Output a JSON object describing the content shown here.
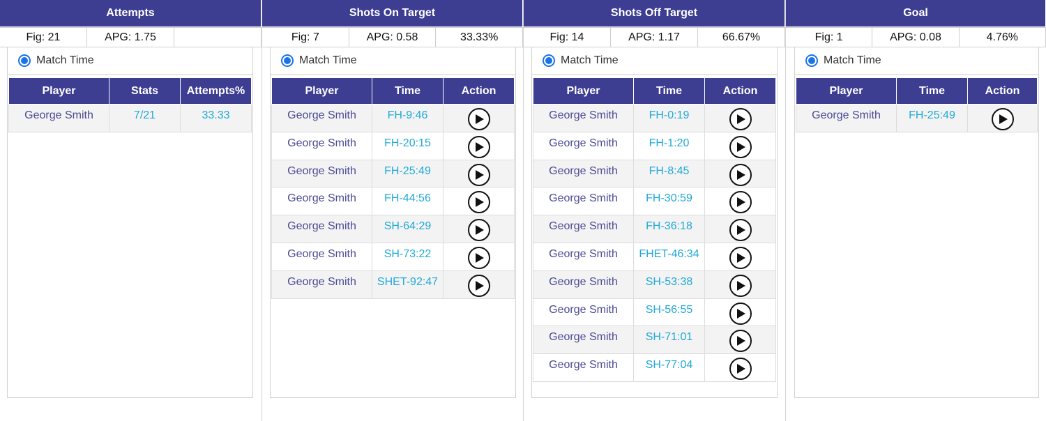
{
  "sections": [
    {
      "title": "Attempts",
      "stats": [
        "Fig: 21",
        "APG: 1.75",
        ""
      ],
      "radio_label": "Match Time",
      "columns": [
        "Player",
        "Stats",
        "Attempts%"
      ],
      "rows": [
        [
          "George Smith",
          "7/21",
          "33.33"
        ]
      ]
    },
    {
      "title": "Shots On Target",
      "stats": [
        "Fig: 7",
        "APG: 0.58",
        "33.33%"
      ],
      "radio_label": "Match Time",
      "columns": [
        "Player",
        "Time",
        "Action"
      ],
      "rows": [
        [
          "George Smith",
          "FH-9:46"
        ],
        [
          "George Smith",
          "FH-20:15"
        ],
        [
          "George Smith",
          "FH-25:49"
        ],
        [
          "George Smith",
          "FH-44:56"
        ],
        [
          "George Smith",
          "SH-64:29"
        ],
        [
          "George Smith",
          "SH-73:22"
        ],
        [
          "George Smith",
          "SHET-92:47"
        ]
      ]
    },
    {
      "title": "Shots Off Target",
      "stats": [
        "Fig: 14",
        "APG: 1.17",
        "66.67%"
      ],
      "radio_label": "Match Time",
      "columns": [
        "Player",
        "Time",
        "Action"
      ],
      "rows": [
        [
          "George Smith",
          "FH-0:19"
        ],
        [
          "George Smith",
          "FH-1:20"
        ],
        [
          "George Smith",
          "FH-8:45"
        ],
        [
          "George Smith",
          "FH-30:59"
        ],
        [
          "George Smith",
          "FH-36:18"
        ],
        [
          "George Smith",
          "FHET-46:34"
        ],
        [
          "George Smith",
          "SH-53:38"
        ],
        [
          "George Smith",
          "SH-56:55"
        ],
        [
          "George Smith",
          "SH-71:01"
        ],
        [
          "George Smith",
          "SH-77:04"
        ]
      ]
    },
    {
      "title": "Goal",
      "stats": [
        "Fig: 1",
        "APG: 0.08",
        "4.76%"
      ],
      "radio_label": "Match Time",
      "columns": [
        "Player",
        "Time",
        "Action"
      ],
      "rows": [
        [
          "George Smith",
          "FH-25:49"
        ]
      ]
    }
  ],
  "icons": {
    "play": "play-circle-icon",
    "radio": "radio-selected-icon"
  },
  "colors": {
    "header": "#3d3d92",
    "player_text": "#4a4a96",
    "time_text": "#1fa9d8",
    "radio": "#1a73e8"
  }
}
